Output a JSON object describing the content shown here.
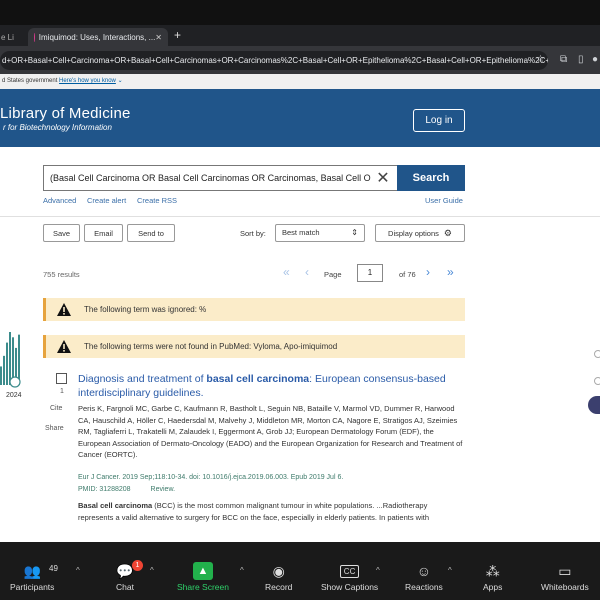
{
  "browser": {
    "tabs": [
      {
        "label": "e Li"
      },
      {
        "label": "Imiquimod: Uses, Interactions, ..."
      }
    ],
    "new_tab_symbol": "+",
    "url": "d+OR+Basal+Cell+Carcinoma+OR+Basal+Cell+Carcinomas+OR+Carcinomas%2C+Basal+Cell+OR+Epithelioma%2C+Basal+Cell+OR+Epithelioma%2C+Basal+Ce..."
  },
  "gov_banner": {
    "text": "d States government",
    "link": "Here's how you know"
  },
  "header": {
    "logo_line1": "Library of Medicine",
    "logo_line2": "r for Biotechnology Information",
    "login": "Log in"
  },
  "search": {
    "query": "(Basal Cell Carcinoma OR Basal Cell Carcinomas OR Carcinomas, Basal Cell O",
    "button": "Search",
    "links": {
      "advanced": "Advanced",
      "create_alert": "Create alert",
      "create_rss": "Create RSS",
      "user_guide": "User Guide"
    }
  },
  "toolbar": {
    "save": "Save",
    "email": "Email",
    "send_to": "Send to",
    "sort_by_label": "Sort by:",
    "sort_value": "Best match",
    "display_options": "Display options"
  },
  "pagination": {
    "results_count": "755 results",
    "page_label": "Page",
    "page_value": "1",
    "of_pages": "of 76"
  },
  "warnings": [
    {
      "text": "The following term was ignored: %"
    },
    {
      "text": "The following terms were not found in PubMed: Vyloma, Apo-imiquimod"
    }
  ],
  "timeline": {
    "year_end": "2024",
    "bars": [
      0.35,
      0.55,
      0.8,
      1.0,
      0.9,
      0.7,
      0.95
    ]
  },
  "article": {
    "number": "1",
    "cite": "Cite",
    "share": "Share",
    "title_pre": "Diagnosis and treatment of ",
    "title_bold": "basal cell carcinoma",
    "title_post": ": European consensus-based interdisciplinary guidelines.",
    "authors": "Peris K, Fargnoli MC, Garbe C, Kaufmann R, Bastholt L, Seguin NB, Bataille V, Marmol VD, Dummer R, Harwood CA, Hauschild A, Höller C, Haedersdal M, Malvehy J, Middleton MR, Morton CA, Nagore E, Stratigos AJ, Szeimies RM, Tagliaferri L, Trakatelli M, Zalaudek I, Eggermont A, Grob JJ; European Dermatology Forum (EDF), the European Association of Dermato-Oncology (EADO) and the European Organization for Research and Treatment of Cancer (EORTC).",
    "citation": "Eur J Cancer. 2019 Sep;118:10-34. doi: 10.1016/j.ejca.2019.06.003. Epub 2019 Jul 6.",
    "pmid": "PMID: 31288208",
    "type": "Review.",
    "snippet_bold": "Basal cell carcinoma",
    "snippet": " (BCC) is the most common malignant tumour in white populations. ...Radiotherapy represents a valid alternative to surgery for BCC on the face, especially in elderly patients. In patients with"
  },
  "zoom": {
    "participants_count": "49",
    "chat_badge": "1",
    "items": {
      "participants": "Participants",
      "chat": "Chat",
      "share_screen": "Share Screen",
      "record": "Record",
      "captions": "Show Captions",
      "reactions": "Reactions",
      "apps": "Apps",
      "whiteboards": "Whiteboards"
    },
    "captions_icon_text": "CC"
  },
  "colors": {
    "header_bg": "#20558a",
    "link": "#2a5ba8",
    "warning_bg": "#fbecc9",
    "share_green": "#22b14c"
  }
}
